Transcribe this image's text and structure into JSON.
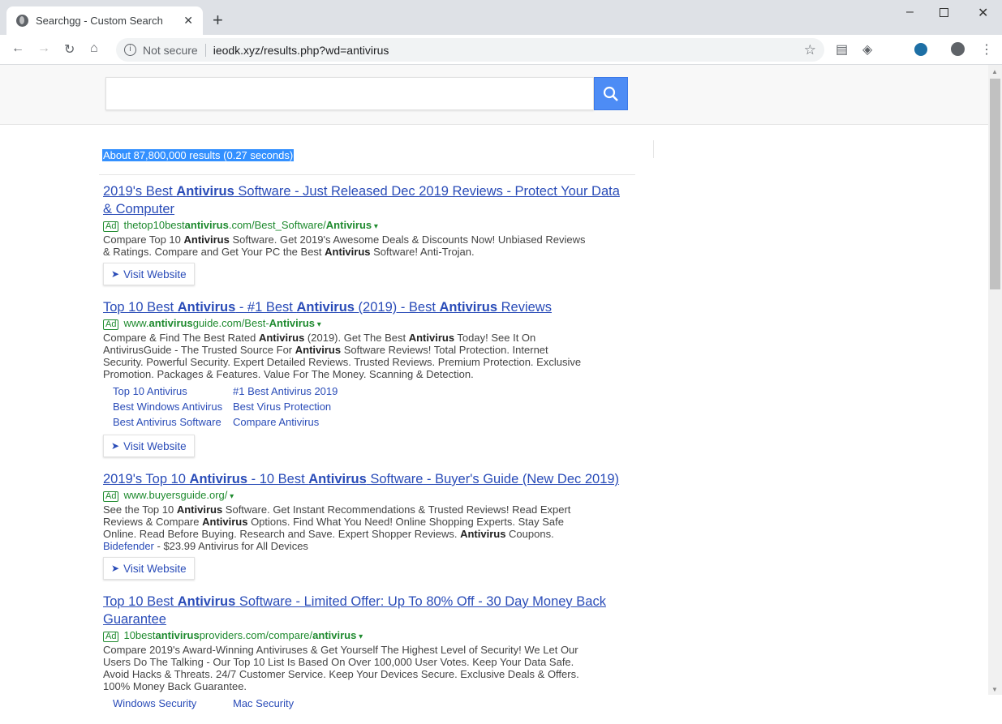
{
  "browser": {
    "tab_title": "Searchgg - Custom Search",
    "not_secure": "Not secure",
    "url": "ieodk.xyz/results.php?wd=antivirus",
    "icons": [
      "globe-icon",
      "close-icon",
      "plus-icon",
      "back-icon",
      "forward-icon",
      "reload-icon",
      "home-icon",
      "info-icon",
      "star-icon",
      "extension-icon",
      "profile-icon",
      "menu-icon"
    ]
  },
  "search": {
    "value": "",
    "button_icon": "search-icon"
  },
  "stats": "About 87,800,000 results (0.27 seconds)",
  "colors": {
    "link": "#2a4cb8",
    "url": "#1e8a2e",
    "button": "#4d8cf5",
    "highlight": "#3390ff"
  },
  "results": [
    {
      "title": [
        [
          "2019's Best ",
          0
        ],
        [
          "Antivirus",
          1
        ],
        [
          " Software - Just Released Dec 2019 Reviews - Protect Your Data & Computer",
          0
        ]
      ],
      "ad": "Ad",
      "url": [
        [
          "thetop10best",
          0
        ],
        [
          "antivirus",
          1
        ],
        [
          ".com/Best_Software/",
          0
        ],
        [
          "Antivirus",
          1
        ]
      ],
      "desc": [
        [
          "Compare Top 10 ",
          0
        ],
        [
          "Antivirus",
          1
        ],
        [
          " Software. Get 2019's Awesome Deals & Discounts Now! Unbiased Reviews & Ratings. Compare and Get Your PC the Best ",
          0
        ],
        [
          "Antivirus",
          1
        ],
        [
          " Software! Anti-Trojan.",
          0
        ]
      ],
      "sitelinks": [],
      "visit": "Visit Website"
    },
    {
      "title": [
        [
          "Top 10 Best ",
          0
        ],
        [
          "Antivirus",
          1
        ],
        [
          " - #1 Best ",
          0
        ],
        [
          "Antivirus",
          1
        ],
        [
          " (2019) - Best ",
          0
        ],
        [
          "Antivirus",
          1
        ],
        [
          " Reviews",
          0
        ]
      ],
      "ad": "Ad",
      "url": [
        [
          "www.",
          0
        ],
        [
          "antivirus",
          1
        ],
        [
          "guide.com/Best-",
          0
        ],
        [
          "Antivirus",
          1
        ]
      ],
      "desc": [
        [
          "Compare & Find The Best Rated ",
          0
        ],
        [
          "Antivirus",
          1
        ],
        [
          " (2019). Get The Best ",
          0
        ],
        [
          "Antivirus",
          1
        ],
        [
          " Today! See It On AntivirusGuide - The Trusted Source For ",
          0
        ],
        [
          "Antivirus",
          1
        ],
        [
          " Software Reviews! Total Protection. Internet Security. Powerful Security. Expert Detailed Reviews. Trusted Reviews. Premium Protection. Exclusive Promotion. Packages & Features. Value For The Money. Scanning & Detection.",
          0
        ]
      ],
      "sitelinks": [
        "Top 10 Antivirus",
        "#1 Best Antivirus 2019",
        "Best Windows Antivirus",
        "Best Virus Protection",
        "Best Antivirus Software",
        "Compare Antivirus"
      ],
      "visit": "Visit Website"
    },
    {
      "title": [
        [
          "2019's Top 10 ",
          0
        ],
        [
          "Antivirus",
          1
        ],
        [
          " - 10 Best ",
          0
        ],
        [
          "Antivirus",
          1
        ],
        [
          " Software - Buyer's Guide (New Dec 2019)",
          0
        ]
      ],
      "ad": "Ad",
      "url": [
        [
          "www.buyersguide.org/",
          0
        ]
      ],
      "desc": [
        [
          "See the Top 10 ",
          0
        ],
        [
          "Antivirus",
          1
        ],
        [
          " Software. Get Instant Recommendations & Trusted Reviews! Read Expert Reviews & Compare ",
          0
        ],
        [
          "Antivirus",
          1
        ],
        [
          " Options. Find What You Need! Online Shopping Experts. Stay Safe Online. Read Before Buying. Research and Save. Expert Shopper Reviews. ",
          0
        ],
        [
          "Antivirus",
          1
        ],
        [
          " Coupons.",
          0
        ]
      ],
      "extra_link": "Bidefender",
      "extra_text": " - $23.99 Antivirus for All Devices",
      "sitelinks": [],
      "visit": "Visit Website"
    },
    {
      "title": [
        [
          "Top 10 Best ",
          0
        ],
        [
          "Antivirus",
          1
        ],
        [
          " Software - Limited Offer: Up To 80% Off - 30 Day Money Back Guarantee",
          0
        ]
      ],
      "ad": "Ad",
      "url": [
        [
          "10best",
          0
        ],
        [
          "antivirus",
          1
        ],
        [
          "providers.com/compare/",
          0
        ],
        [
          "antivirus",
          1
        ]
      ],
      "desc": [
        [
          "Compare 2019's Award-Winning Antiviruses & Get Yourself The Highest Level of Security! We Let Our Users Do The Talking - Our Top 10 List Is Based On Over 100,000 User Votes. Keep Your Data Safe. Avoid Hacks & Threats. 24/7 Customer Service. Keep Your Devices Secure. Exclusive Deals & Offers. 100% Money Back Guarantee.",
          0
        ]
      ],
      "sitelinks": [
        "Windows Security",
        "Mac Security"
      ]
    }
  ]
}
